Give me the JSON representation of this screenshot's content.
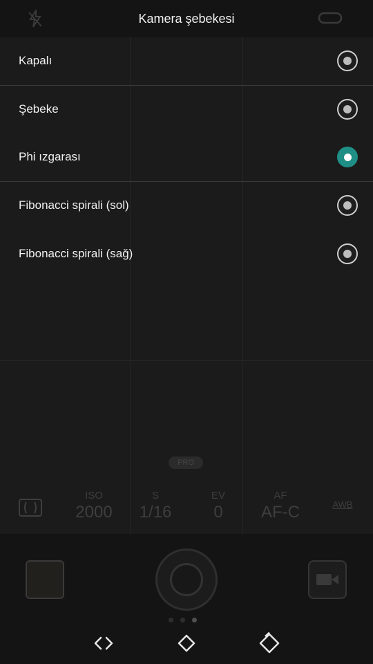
{
  "header": {
    "title": "Kamera şebekesi"
  },
  "menu": {
    "items": [
      {
        "label": "Kapalı",
        "selected": false
      },
      {
        "label": "Şebeke",
        "selected": false
      },
      {
        "label": "Phi ızgarası",
        "selected": true
      },
      {
        "label": "Fibonacci spirali (sol)",
        "selected": false
      },
      {
        "label": "Fibonacci spirali (sağ)",
        "selected": false
      }
    ]
  },
  "pro_mode": {
    "badge": "PRO",
    "metering_icon": "metering-icon",
    "iso": {
      "label": "ISO",
      "value": "2000"
    },
    "shutter": {
      "label": "S",
      "value": "1/16"
    },
    "ev": {
      "label": "EV",
      "value": "0"
    },
    "af": {
      "label": "AF",
      "value": "AF-C"
    },
    "wb": {
      "label": "AWB"
    }
  },
  "colors": {
    "accent": "#1f8f86",
    "background": "#161616"
  },
  "navbar": {
    "back_icon": "back-icon",
    "home_icon": "home-icon",
    "recents_icon": "recents-icon"
  }
}
